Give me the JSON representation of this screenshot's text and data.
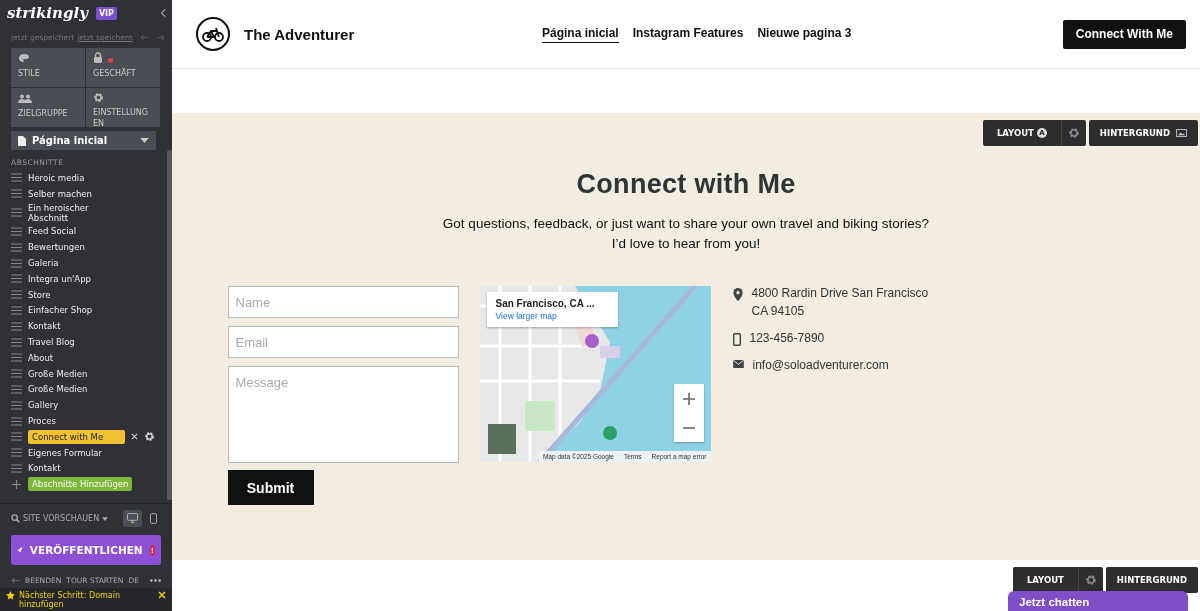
{
  "sidebar": {
    "logo": "strikingly",
    "badge": "VIP",
    "save_status": "jetzt gespeichert",
    "save_link": "jetzt speichern",
    "tiles": [
      {
        "label": "STILE",
        "kind": "palette",
        "alert": false
      },
      {
        "label": "GESCHÄFT",
        "kind": "lock",
        "alert": true
      },
      {
        "label": "ZIELGRUPPE",
        "kind": "people",
        "alert": false
      },
      {
        "label": "EINSTELLUNGEN",
        "kind": "gear",
        "alert": false
      }
    ],
    "page_select": "Página inicial",
    "sections_heading": "ABSCHNITTE",
    "sections": [
      {
        "label": "Heroic media",
        "selected": false
      },
      {
        "label": "Selber machen",
        "selected": false
      },
      {
        "label": "Ein heroischer Abschnitt",
        "selected": false
      },
      {
        "label": "Feed Social",
        "selected": false
      },
      {
        "label": "Bewertungen",
        "selected": false
      },
      {
        "label": "Galeria",
        "selected": false
      },
      {
        "label": "Integra un'App",
        "selected": false
      },
      {
        "label": "Store",
        "selected": false
      },
      {
        "label": "Einfacher Shop",
        "selected": false
      },
      {
        "label": "Kontakt",
        "selected": false
      },
      {
        "label": "Travel Blog",
        "selected": false
      },
      {
        "label": "About",
        "selected": false
      },
      {
        "label": "Große Medien",
        "selected": false
      },
      {
        "label": "Große Medien",
        "selected": false
      },
      {
        "label": "Gallery",
        "selected": false
      },
      {
        "label": "Proces",
        "selected": false
      },
      {
        "label": "Connect with Me",
        "selected": true
      },
      {
        "label": "Eigenes Formular",
        "selected": false
      },
      {
        "label": "Kontakt",
        "selected": false
      }
    ],
    "add_section": "Abschnitte Hinzufügen",
    "preview": "SITE VORSCHAUEN",
    "devices": [
      {
        "kind": "desktop",
        "selected": true
      },
      {
        "kind": "mobile",
        "selected": false
      }
    ],
    "publish": "VERÖFFENTLICHEN",
    "publish_alert": "!",
    "footer_links": [
      "BEENDEN",
      "TOUR STARTEN",
      "DE"
    ],
    "next_step": "Nächster Schritt: Domain hinzufügen"
  },
  "site_header": {
    "brand": "The Adventurer",
    "nav": [
      {
        "label": "Página inicial",
        "selected": true
      },
      {
        "label": "Instagram Features",
        "selected": false
      },
      {
        "label": "Nieuwe pagina 3",
        "selected": false
      }
    ],
    "cta": "Connect With Me"
  },
  "section": {
    "toolbar": {
      "layout": "LAYOUT",
      "layout_badge": "A",
      "background": "HINTERGRUND"
    },
    "title": "Connect with Me",
    "subtitle": [
      "Got questions, feedback, or just want to share your own travel and biking stories?",
      "I’d love to hear from you!"
    ],
    "form": {
      "fields": [
        {
          "placeholder": "Name",
          "kind": "line"
        },
        {
          "placeholder": "Email",
          "kind": "line"
        },
        {
          "placeholder": "Message",
          "kind": "area"
        }
      ],
      "submit": "Submit"
    },
    "map": {
      "kind": "picture",
      "place": "San Francisco, CA ...",
      "link": "View larger map",
      "attribution": "Map data ©2025 Google",
      "terms": "Terms",
      "report": "Report a map error"
    },
    "contact": [
      {
        "kind": "pin",
        "text": "4800 Rardin Drive San Francisco CA 94105"
      },
      {
        "kind": "phone",
        "text": "123-456-7890"
      },
      {
        "kind": "mail",
        "text": "info@soloadventurer.com"
      }
    ]
  },
  "bottom_toolbar": {
    "layout": "LAYOUT",
    "background": "HINTERGRUND"
  },
  "chat": "Jetzt chatten"
}
